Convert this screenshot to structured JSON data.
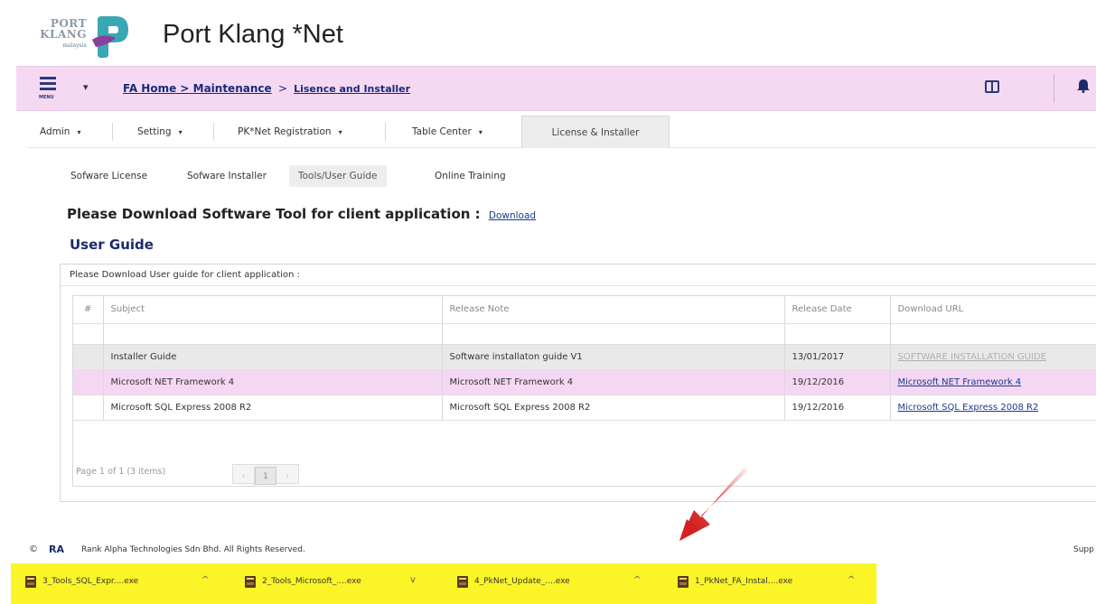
{
  "app": {
    "title": "Port Klang *Net",
    "logo": {
      "line1": "PORT",
      "line2": "KLANG",
      "line3": "malaysia"
    }
  },
  "navbar": {
    "menu_label": "MENU",
    "breadcrumb": {
      "home": "FA Home > Maintenance",
      "sep": ">",
      "current": "Lisence and Installer"
    }
  },
  "tabs": [
    {
      "label": "Admin"
    },
    {
      "label": "Setting"
    },
    {
      "label": "PK*Net Registration"
    },
    {
      "label": "Table Center"
    },
    {
      "label": "License & Installer"
    }
  ],
  "subtabs": [
    {
      "label": "Sofware License"
    },
    {
      "label": "Sofware Installer"
    },
    {
      "label": "Tools/User Guide"
    },
    {
      "label": "Online Training"
    }
  ],
  "download_section": {
    "text": "Please Download Software Tool for client application :",
    "link": "Download"
  },
  "user_guide": {
    "title": "User Guide",
    "caption": "Please Download User guide for client application :",
    "columns": {
      "hash": "#",
      "subject": "Subject",
      "note": "Release Note",
      "date": "Release Date",
      "url": "Download URL"
    },
    "rows": [
      {
        "subject": "Installer Guide",
        "note": "Software installaton guide V1",
        "date": "13/01/2017",
        "url": "SOFTWARE INSTALLATION GUIDE"
      },
      {
        "subject": "Microsoft NET Framework 4",
        "note": "Microsoft NET Framework 4",
        "date": "19/12/2016",
        "url": "Microsoft NET Framework 4"
      },
      {
        "subject": "Microsoft SQL Express 2008 R2",
        "note": "Microsoft SQL Express 2008 R2",
        "date": "19/12/2016",
        "url": "Microsoft SQL Express 2008 R2"
      }
    ],
    "pager": {
      "text": "Page 1 of 1 (3 items)",
      "prev": "‹",
      "page": "1",
      "next": "›"
    }
  },
  "footer": {
    "copyright_symbol": "©",
    "company_mark": "RA",
    "text": "Rank Alpha Technologies Sdn Bhd.   All Rights Reserved.",
    "right": "Supp"
  },
  "downloads": [
    {
      "name": "3_Tools_SQL_Expr....exe",
      "chevron": "^"
    },
    {
      "name": "2_Tools_Microsoft_....exe",
      "chevron": "v"
    },
    {
      "name": "4_PkNet_Update_....exe",
      "chevron": "^"
    },
    {
      "name": "1_PkNet_FA_Instal....exe",
      "chevron": "^"
    }
  ],
  "colors": {
    "navbar_bg": "#f5d9f3",
    "brand_blue": "#1c2a6a",
    "download_bar": "#fbf528",
    "arrow_red": "#d62020"
  }
}
